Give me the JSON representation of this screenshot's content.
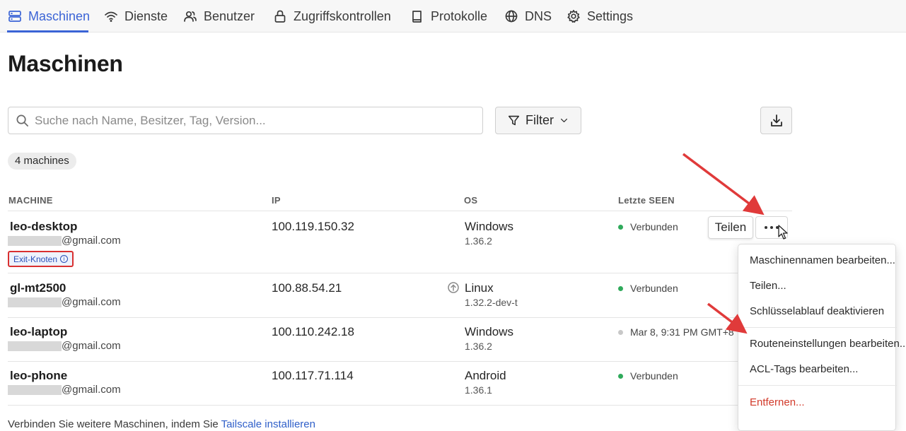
{
  "nav": {
    "items": [
      {
        "label": "Maschinen",
        "icon": "server-icon",
        "active": true
      },
      {
        "label": "Dienste",
        "icon": "wifi-icon"
      },
      {
        "label": "Benutzer",
        "icon": "users-icon"
      },
      {
        "label": "Zugriffskontrollen",
        "icon": "lock-icon"
      },
      {
        "label": "Protokolle",
        "icon": "book-icon"
      },
      {
        "label": "DNS",
        "icon": "globe-icon"
      },
      {
        "label": "Settings",
        "icon": "gear-icon"
      }
    ],
    "accent": "#3b64d6"
  },
  "page": {
    "title": "Maschinen"
  },
  "search": {
    "placeholder": "Suche nach Name, Besitzer, Tag, Version..."
  },
  "filter": {
    "label": "Filter"
  },
  "count": "4 machines",
  "table": {
    "headers": {
      "machine": "MACHINE",
      "ip": "IP",
      "os": "OS",
      "last_seen": "Letzte SEEN"
    },
    "rows": [
      {
        "name": "leo-desktop",
        "owner": "@gmail.com",
        "tag": "Exit-Knoten",
        "ip": "100.119.150.32",
        "os": "Windows",
        "version": "1.36.2",
        "status": "Verbunden",
        "status_color": "#2faa5b"
      },
      {
        "name": "gl-mt2500",
        "owner": "@gmail.com",
        "ip": "100.88.54.21",
        "os": "Linux",
        "version": "1.32.2-dev-t",
        "status": "Verbunden",
        "status_color": "#2faa5b"
      },
      {
        "name": "leo-laptop",
        "owner": "@gmail.com",
        "ip": "100.110.242.18",
        "os": "Windows",
        "version": "1.36.2",
        "status": "Mar 8, 9:31 PM GMT+8",
        "status_color": "#c8c8c8"
      },
      {
        "name": "leo-phone",
        "owner": "@gmail.com",
        "ip": "100.117.71.114",
        "os": "Android",
        "version": "1.36.1",
        "status": "Verbunden",
        "status_color": "#2faa5b"
      }
    ]
  },
  "row_actions": {
    "share_chip": "Teilen"
  },
  "menu": {
    "items": [
      "Maschinennamen bearbeiten...",
      "Teilen...",
      "Schlüsselablauf deaktivieren",
      "Routeneinstellungen bearbeiten...",
      "ACL-Tags bearbeiten...",
      "Entfernen..."
    ]
  },
  "footer": {
    "text": "Verbinden Sie weitere Maschinen, indem Sie ",
    "link": "Tailscale installieren"
  },
  "annotation_color": "#e03a3a"
}
